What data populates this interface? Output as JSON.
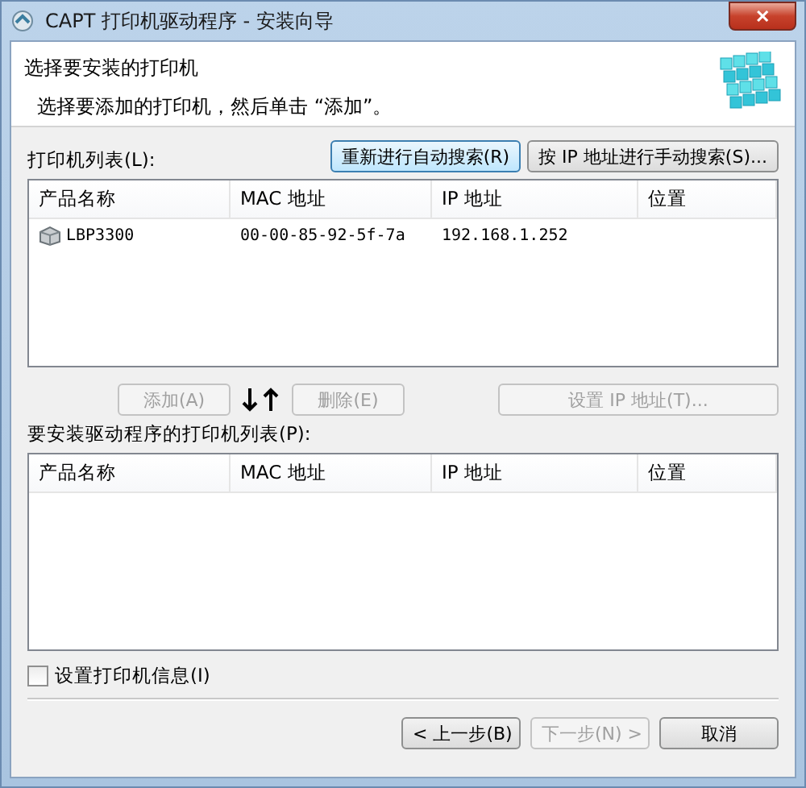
{
  "window": {
    "title": "CAPT 打印机驱动程序 - 安装向导",
    "close": "✕"
  },
  "header": {
    "title": "选择要安装的打印机",
    "subtitle": "选择要添加的打印机，然后单击 “添加”。"
  },
  "printer_list": {
    "label": "打印机列表(L):",
    "buttons": [
      {
        "label": "重新进行自动搜索(R)",
        "focused": true,
        "disabled": false
      },
      {
        "label": "按 IP 地址进行手动搜索(S)...",
        "focused": false,
        "disabled": false
      }
    ],
    "columns": [
      "产品名称",
      "MAC 地址",
      "IP 地址",
      "位置"
    ],
    "rows": [
      {
        "cells": [
          "LBP3300",
          "00-00-85-92-5f-7a",
          "192.168.1.252",
          ""
        ]
      }
    ]
  },
  "transfer": {
    "add": {
      "label": "添加(A)",
      "disabled": true
    },
    "remove": {
      "label": "删除(E)",
      "disabled": true
    },
    "set_ip": {
      "label": "设置 IP 地址(T)...",
      "disabled": true
    }
  },
  "install_list": {
    "label": "要安装驱动程序的打印机列表(P):",
    "columns": [
      "产品名称",
      "MAC 地址",
      "IP 地址",
      "位置"
    ]
  },
  "printer_info": {
    "label": "设置打印机信息(I)",
    "checked": false
  },
  "footer": {
    "buttons": [
      {
        "label": "< 上一步(B)",
        "disabled": false
      },
      {
        "label": "下一步(N) >",
        "disabled": true
      },
      {
        "label": "取消",
        "disabled": false
      }
    ]
  }
}
